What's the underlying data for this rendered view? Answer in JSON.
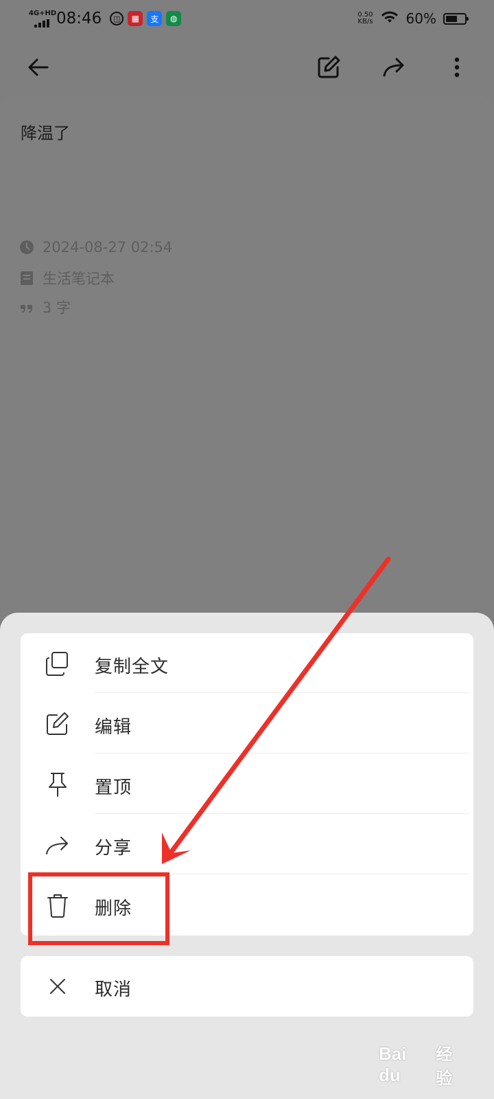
{
  "status_bar": {
    "network": "4G+HD",
    "time": "08:46",
    "apps": [
      {
        "icon": "unionpay-icon",
        "glyph": "◫"
      },
      {
        "icon": "red-app-icon",
        "glyph": "▦"
      },
      {
        "icon": "alipay-icon",
        "glyph": "支"
      },
      {
        "icon": "green-app-icon",
        "glyph": "◍"
      }
    ],
    "speed_value": "0.50",
    "speed_unit": "KB/s",
    "battery_percent": "60%",
    "battery_level": 0.6
  },
  "header": {
    "back_icon": "arrow-left-icon",
    "edit_icon": "edit-icon",
    "share_icon": "share-icon",
    "more_icon": "more-vertical-icon"
  },
  "note": {
    "title": "降温了",
    "timestamp": "2024-08-27 02:54",
    "notebook": "生活笔记本",
    "word_count": "3 字"
  },
  "menu": {
    "items": [
      {
        "label": "复制全文",
        "icon": "copy-icon"
      },
      {
        "label": "编辑",
        "icon": "edit-icon"
      },
      {
        "label": "置顶",
        "icon": "pin-icon"
      },
      {
        "label": "分享",
        "icon": "share-icon"
      },
      {
        "label": "删除",
        "icon": "trash-icon"
      }
    ],
    "cancel_label": "取消"
  },
  "annotation": {
    "color": "#ee3028"
  },
  "watermark": {
    "logo": "Bai du",
    "text": "经验"
  },
  "colors": {
    "overlay": "#7f7f7f",
    "sheet": "#e6e6e6",
    "card": "#ffffff",
    "annotation": "#ee3028"
  }
}
